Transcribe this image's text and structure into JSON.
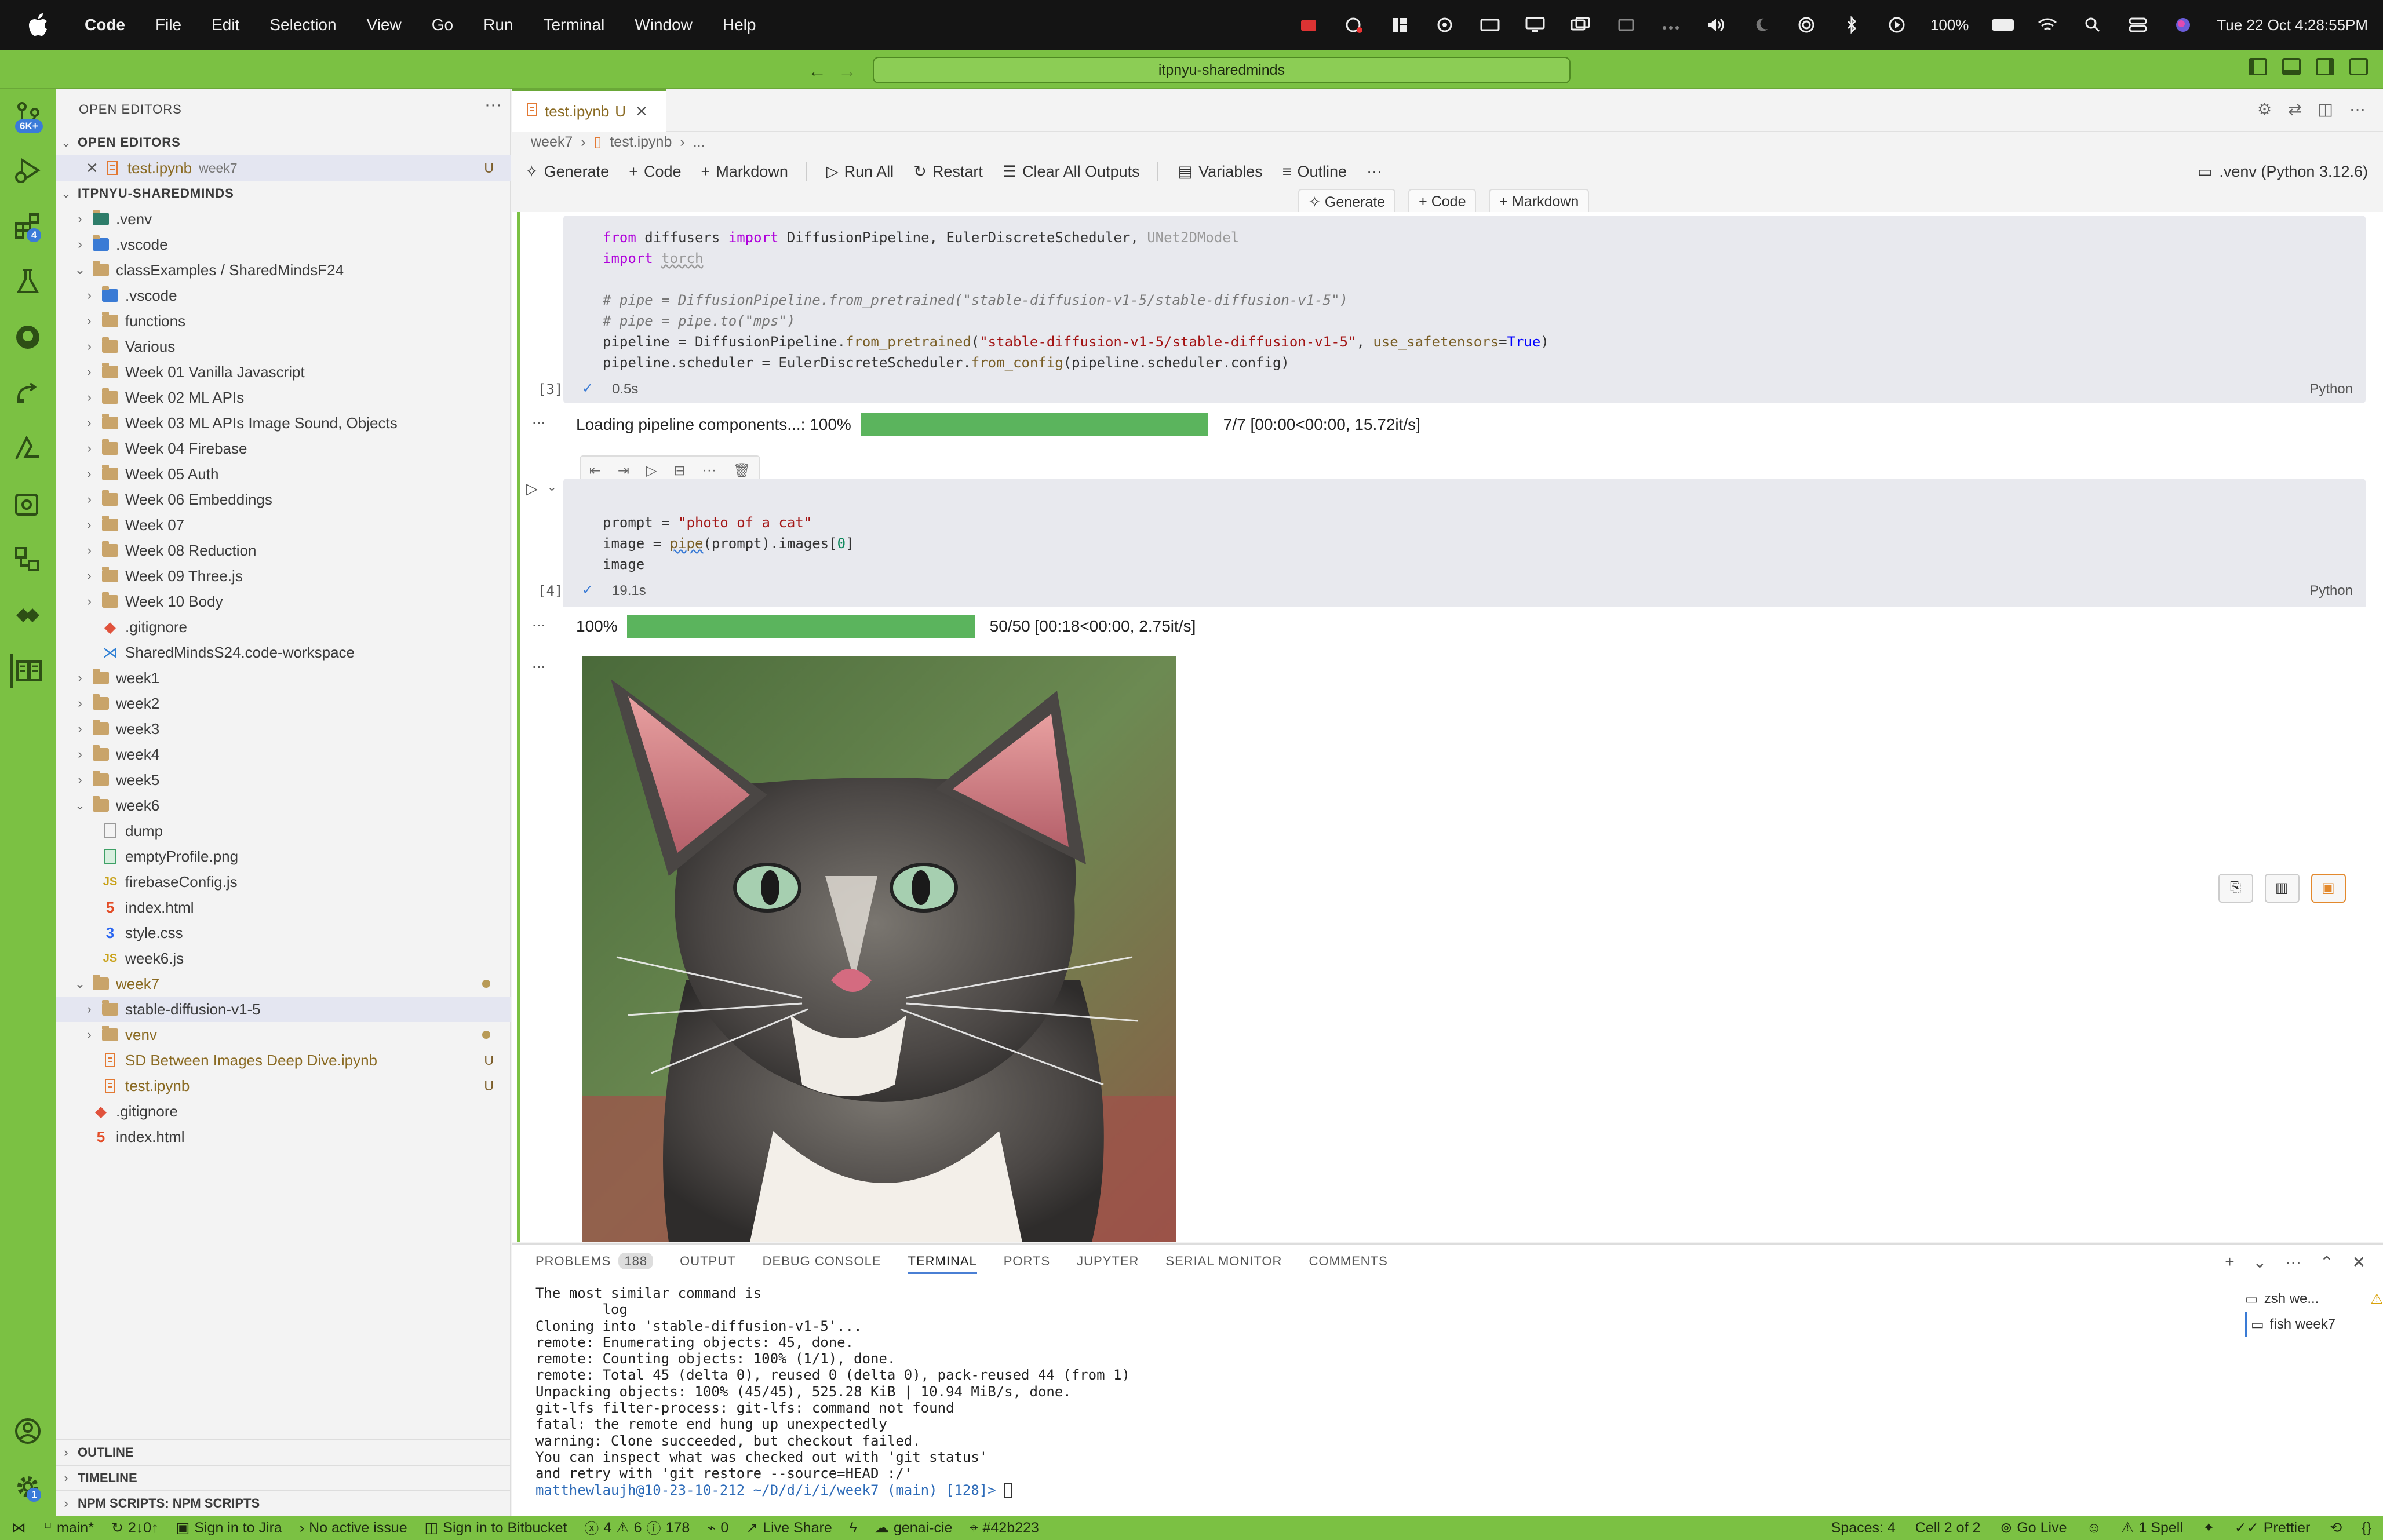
{
  "menubar": {
    "app": "Code",
    "items": [
      "File",
      "Edit",
      "Selection",
      "View",
      "Go",
      "Run",
      "Terminal",
      "Window",
      "Help"
    ],
    "battery": "100%",
    "clock": "Tue 22 Oct 4:28:55PM"
  },
  "titlebar": {
    "search": "itpnyu-sharedminds"
  },
  "activity": {
    "scm_badge": "6K+",
    "ext_badge": "4",
    "settings_badge": "1"
  },
  "sidebar": {
    "open_editors_title": "OPEN EDITORS",
    "open_editors_section": "OPEN EDITORS",
    "open_file": "test.ipynb",
    "open_file_folder": "week7",
    "open_file_mark": "U",
    "workspace": "ITPNYU-SHAREDMINDS",
    "items": [
      {
        "label": ".venv",
        "depth": 1,
        "type": "folder-venv",
        "collapsed": true
      },
      {
        "label": ".vscode",
        "depth": 1,
        "type": "folder-vscode",
        "collapsed": true
      },
      {
        "label": "classExamples / SharedMindsF24",
        "depth": 1,
        "type": "folder",
        "collapsed": false
      },
      {
        "label": ".vscode",
        "depth": 2,
        "type": "folder-vscode",
        "collapsed": true
      },
      {
        "label": "functions",
        "depth": 2,
        "type": "folder",
        "collapsed": true
      },
      {
        "label": "Various",
        "depth": 2,
        "type": "folder",
        "collapsed": true
      },
      {
        "label": "Week 01  Vanilla Javascript",
        "depth": 2,
        "type": "folder",
        "collapsed": true
      },
      {
        "label": "Week 02 ML APIs",
        "depth": 2,
        "type": "folder",
        "collapsed": true
      },
      {
        "label": "Week 03 ML APIs Image Sound, Objects",
        "depth": 2,
        "type": "folder",
        "collapsed": true
      },
      {
        "label": "Week 04 Firebase",
        "depth": 2,
        "type": "folder",
        "collapsed": true
      },
      {
        "label": "Week 05 Auth",
        "depth": 2,
        "type": "folder",
        "collapsed": true
      },
      {
        "label": "Week 06 Embeddings",
        "depth": 2,
        "type": "folder",
        "collapsed": true
      },
      {
        "label": "Week 07",
        "depth": 2,
        "type": "folder",
        "collapsed": true
      },
      {
        "label": "Week 08 Reduction",
        "depth": 2,
        "type": "folder",
        "collapsed": true
      },
      {
        "label": "Week 09 Three.js",
        "depth": 2,
        "type": "folder",
        "collapsed": true
      },
      {
        "label": "Week 10 Body",
        "depth": 2,
        "type": "folder",
        "collapsed": true
      },
      {
        "label": ".gitignore",
        "depth": 2,
        "type": "git"
      },
      {
        "label": "SharedMindsS24.code-workspace",
        "depth": 2,
        "type": "vscode"
      },
      {
        "label": "week1",
        "depth": 1,
        "type": "folder",
        "collapsed": true
      },
      {
        "label": "week2",
        "depth": 1,
        "type": "folder",
        "collapsed": true
      },
      {
        "label": "week3",
        "depth": 1,
        "type": "folder",
        "collapsed": true
      },
      {
        "label": "week4",
        "depth": 1,
        "type": "folder",
        "collapsed": true
      },
      {
        "label": "week5",
        "depth": 1,
        "type": "folder",
        "collapsed": true
      },
      {
        "label": "week6",
        "depth": 1,
        "type": "folder",
        "collapsed": false
      },
      {
        "label": "dump",
        "depth": 2,
        "type": "file"
      },
      {
        "label": "emptyProfile.png",
        "depth": 2,
        "type": "image"
      },
      {
        "label": "firebaseConfig.js",
        "depth": 2,
        "type": "js"
      },
      {
        "label": "index.html",
        "depth": 2,
        "type": "html"
      },
      {
        "label": "style.css",
        "depth": 2,
        "type": "css"
      },
      {
        "label": "week6.js",
        "depth": 2,
        "type": "js"
      },
      {
        "label": "week7",
        "depth": 1,
        "type": "folder",
        "collapsed": false,
        "modified": true,
        "dot": true
      },
      {
        "label": "stable-diffusion-v1-5",
        "depth": 2,
        "type": "folder",
        "collapsed": true,
        "selected": true
      },
      {
        "label": "venv",
        "depth": 2,
        "type": "folder",
        "collapsed": true,
        "modified": true,
        "dot": true
      },
      {
        "label": "SD Between Images Deep Dive.ipynb",
        "depth": 2,
        "type": "ipynb",
        "modified": true,
        "mark": "U"
      },
      {
        "label": "test.ipynb",
        "depth": 2,
        "type": "ipynb",
        "modified": true,
        "mark": "U"
      },
      {
        "label": ".gitignore",
        "depth": 1,
        "type": "git"
      },
      {
        "label": "index.html",
        "depth": 1,
        "type": "html"
      }
    ],
    "outline": "OUTLINE",
    "timeline": "TIMELINE",
    "npm": "NPM SCRIPTS: NPM SCRIPTS"
  },
  "editor": {
    "tab_label": "test.ipynb",
    "tab_mark": "U",
    "breadcrumb": [
      "week7",
      "test.ipynb",
      "..."
    ],
    "toolbar": [
      "Generate",
      "Code",
      "Markdown",
      "Run All",
      "Restart",
      "Clear All Outputs",
      "Variables",
      "Outline"
    ],
    "kernel": ".venv (Python 3.12.6)",
    "cell_add": [
      "Generate",
      "Code",
      "Markdown"
    ],
    "cell1": {
      "lines": [
        "from diffusers import DiffusionPipeline, EulerDiscreteScheduler, UNet2DModel",
        "import torch",
        "",
        "# pipe = DiffusionPipeline.from_pretrained(\"stable-diffusion-v1-5/stable-diffusion-v1-5\")",
        "# pipe = pipe.to(\"mps\")",
        "pipeline = DiffusionPipeline.from_pretrained(\"stable-diffusion-v1-5/stable-diffusion-v1-5\", use_safetensors=True)",
        "pipeline.scheduler = EulerDiscreteScheduler.from_config(pipeline.scheduler.config)"
      ],
      "count": "[3]",
      "time": "0.5s",
      "lang": "Python"
    },
    "out1": {
      "label": "Loading  pipeline  components...:  100%",
      "progress": 1.0,
      "stats": "7/7  [00:00<00:00,  15.72it/s]"
    },
    "cell2": {
      "lines": [
        "prompt = \"photo of a cat\"",
        "image = pipe(prompt).images[0]",
        "image"
      ],
      "count": "[4]",
      "time": "19.1s",
      "lang": "Python"
    },
    "out2": {
      "label": "100%",
      "progress": 1.0,
      "stats": "50/50  [00:18<00:00,    2.75it/s]"
    },
    "ellipsis": "..."
  },
  "panel": {
    "tabs": [
      "PROBLEMS",
      "188",
      "OUTPUT",
      "DEBUG CONSOLE",
      "TERMINAL",
      "PORTS",
      "JUPYTER",
      "SERIAL MONITOR",
      "COMMENTS"
    ],
    "terminal": "The most similar command is\n        log\nCloning into 'stable-diffusion-v1-5'...\nremote: Enumerating objects: 45, done.\nremote: Counting objects: 100% (1/1), done.\nremote: Total 45 (delta 0), reused 0 (delta 0), pack-reused 44 (from 1)\nUnpacking objects: 100% (45/45), 525.28 KiB | 10.94 MiB/s, done.\ngit-lfs filter-process: git-lfs: command not found\nfatal: the remote end hung up unexpectedly\nwarning: Clone succeeded, but checkout failed.\nYou can inspect what was checked out with 'git status'\nand retry with 'git restore --source=HEAD :/'\n",
    "prompt": "matthewlaujh@10-23-10-212 ~/D/d/i/i/week7 (main) [128]> ",
    "shells": [
      "zsh we...",
      "fish week7"
    ]
  },
  "status": {
    "left": [
      "main*",
      "2↓0↑",
      "Sign in to Jira",
      "No active issue",
      "Sign in to Bitbucket",
      "4",
      "6",
      "178",
      "0",
      "Live Share",
      "genai-cie",
      "#42b223"
    ],
    "right": [
      "Spaces: 4",
      "Cell 2 of 2",
      "Go Live",
      "1 Spell",
      "Prettier"
    ]
  }
}
